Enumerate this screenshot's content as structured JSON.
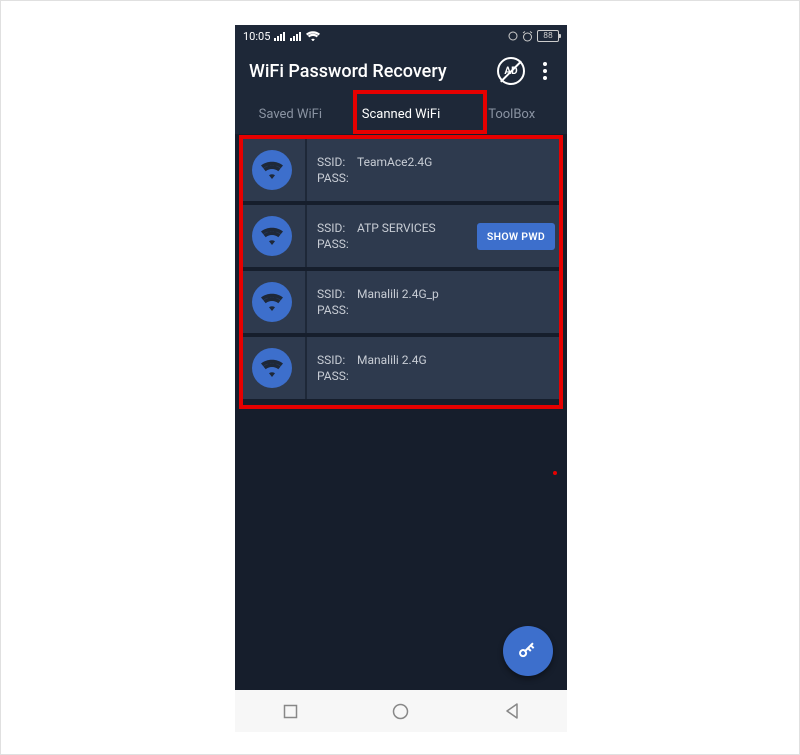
{
  "statusbar": {
    "time": "10:05",
    "battery": "88"
  },
  "header": {
    "title": "WiFi Password Recovery",
    "ad_label": "AD"
  },
  "tabs": [
    {
      "label": "Saved WiFi",
      "active": false
    },
    {
      "label": "Scanned WiFi",
      "active": true
    },
    {
      "label": "ToolBox",
      "active": false
    }
  ],
  "labels": {
    "ssid": "SSID:",
    "pass": "PASS:",
    "show_pwd": "SHOW PWD"
  },
  "networks": [
    {
      "ssid": "TeamAce2.4G",
      "pass": "",
      "show_button": false
    },
    {
      "ssid": "ATP SERVICES",
      "pass": "",
      "show_button": true
    },
    {
      "ssid": "Manalili 2.4G_p",
      "pass": "",
      "show_button": false
    },
    {
      "ssid": "Manalili 2.4G",
      "pass": "",
      "show_button": false
    }
  ]
}
